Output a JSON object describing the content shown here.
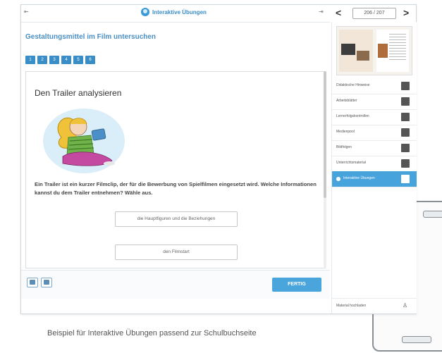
{
  "app": {
    "title": "Interaktive Übungen",
    "expand_icon": "expand-icon",
    "collapse_icon": "collapse-icon",
    "accent_color": "#3a8ec7"
  },
  "pager": {
    "prev_icon": "chevron-left-icon",
    "next_icon": "chevron-right-icon",
    "page_text": "206 / 207"
  },
  "exercise": {
    "title": "Gestaltungsmittel im Film untersuchen",
    "steps": [
      "1",
      "2",
      "3",
      "4",
      "5",
      "6"
    ],
    "card_title": "Den Trailer analysieren",
    "question": "Ein Trailer ist ein kurzer Filmclip, der für die Bewerbung von Spielfilmen eingesetzt wird. Welche Informationen kannst du dem Trailer entnehmen? Wähle aus.",
    "answers": [
      "die Hauptfiguren und die Beziehungen",
      "den Filmstart"
    ],
    "done_label": "FERTIG"
  },
  "sidebar": {
    "items": [
      {
        "label": "Didaktische Hinweise",
        "icon": "note-icon"
      },
      {
        "label": "Arbeitsblätter",
        "icon": "worksheet-icon"
      },
      {
        "label": "Lernerfolgskontrollen",
        "icon": "checklist-icon"
      },
      {
        "label": "Medienpool",
        "icon": "media-icon"
      },
      {
        "label": "Bildfolgen",
        "icon": "images-icon"
      },
      {
        "label": "Unterrichtsmaterial",
        "icon": "folder-icon"
      },
      {
        "label": "Interaktive Übungen",
        "icon": "exercise-icon",
        "active": true
      }
    ],
    "bottom_label": "Material hochladen",
    "bottom_icon": "user-icon"
  },
  "caption": "Beispiel für Interaktive Übungen passend zur Schulbuchseite"
}
